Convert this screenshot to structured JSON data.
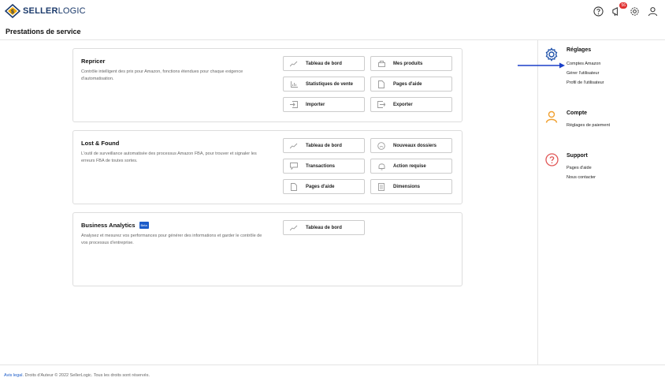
{
  "brand": {
    "logo_text": "SELLERLOGIC",
    "logo_part1": "SELLER",
    "logo_part2": "LOGIC"
  },
  "header": {
    "notification_count": "56"
  },
  "page": {
    "title": "Prestations de service"
  },
  "cards": [
    {
      "title": "Repricer",
      "description": "Contrôle intelligent des prix pour Amazon, fonctions étendues pour chaque exigence d'automatisation.",
      "actions": [
        "Tableau de bord",
        "Mes produits",
        "Statistiques de vente",
        "Pages d'aide",
        "Importer",
        "Exporter"
      ]
    },
    {
      "title": "Lost & Found",
      "description": "L'outil de surveillance automatisée des processus Amazon FBA, pour trouver et signaler les erreurs FBA de toutes sortes.",
      "actions": [
        "Tableau de bord",
        "Nouveaux dossiers",
        "Transactions",
        "Action requise",
        "Pages d'aide",
        "Dimensions"
      ]
    },
    {
      "title": "Business Analytics",
      "badge": "Beta",
      "description": "Analysez et mesurez vos performances pour générer des informations et garder le contrôle de vos processus d'entreprise.",
      "actions": [
        "Tableau de bord"
      ]
    }
  ],
  "sidebar": {
    "settings": {
      "title": "Réglages",
      "links": [
        "Comptes Amazon",
        "Gérer l'utilisateur",
        "Profil de l'utilisateur"
      ]
    },
    "account": {
      "title": "Compte",
      "links": [
        "Réglages de paiement"
      ]
    },
    "support": {
      "title": "Support",
      "links": [
        "Pages d'aide",
        "Nous contacter"
      ]
    }
  },
  "footer": {
    "legal_link": "Avis legal",
    "copyright": ". Droits d'Auteur © 2022 SellerLogic. Tous les droits sont réservés."
  },
  "colors": {
    "accent_blue": "#1c5cc9",
    "settings_icon": "#1c4fa8",
    "account_icon": "#f0a030",
    "support_icon": "#e05555",
    "arrow": "#1a3fc8"
  }
}
